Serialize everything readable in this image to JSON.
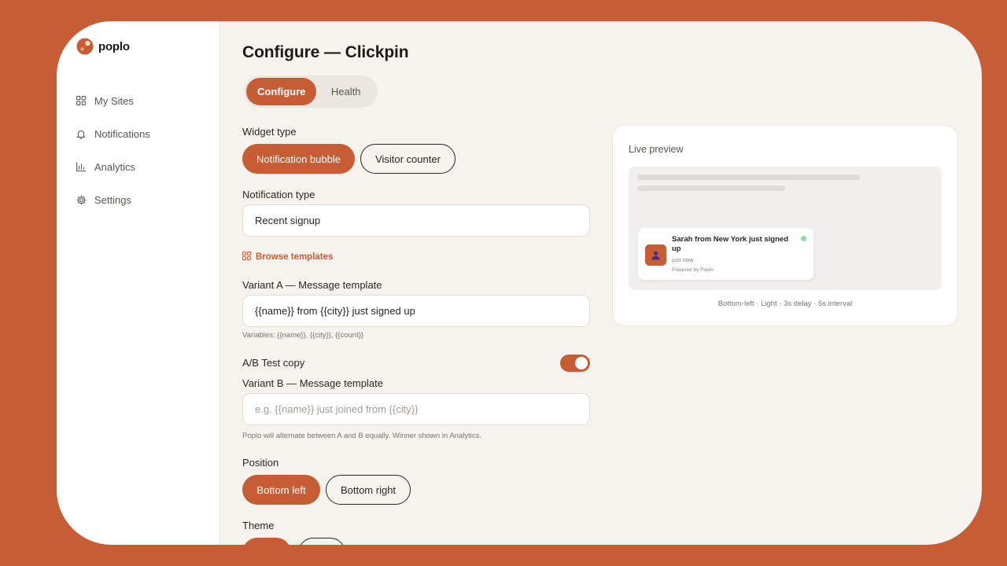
{
  "app": {
    "name": "poplo"
  },
  "sidebar": {
    "items": [
      {
        "label": "My Sites",
        "icon": "grid-icon"
      },
      {
        "label": "Notifications",
        "icon": "bell-icon"
      },
      {
        "label": "Analytics",
        "icon": "bar-chart-icon"
      },
      {
        "label": "Settings",
        "icon": "gear-icon"
      }
    ]
  },
  "page": {
    "title": "Configure — Clickpin"
  },
  "tabs": [
    {
      "label": "Configure",
      "active": true
    },
    {
      "label": "Health",
      "active": false
    }
  ],
  "form": {
    "widget_type": {
      "label": "Widget type",
      "options": [
        "Notification bubble",
        "Visitor counter"
      ],
      "selected": "Notification bubble"
    },
    "notification_type": {
      "label": "Notification type",
      "value": "Recent signup"
    },
    "browse_templates": "Browse templates",
    "variant_a": {
      "label": "Variant A — Message template",
      "value": "{{name}} from {{city}} just signed up",
      "hint": "Variables: {{name}}, {{city}}, {{count}}"
    },
    "ab_test": {
      "label": "A/B Test copy",
      "enabled": true
    },
    "variant_b": {
      "label": "Variant B — Message template",
      "placeholder": "e.g. {{name}} just joined from {{city}}",
      "hint": "Poplo will alternate between A and B equally. Winner shown in Analytics."
    },
    "position": {
      "label": "Position",
      "options": [
        "Bottom left",
        "Bottom right"
      ],
      "selected": "Bottom left"
    },
    "theme": {
      "label": "Theme"
    }
  },
  "preview": {
    "title": "Live preview",
    "notification": {
      "message": "Sarah from New York just signed up",
      "time": "just now",
      "powered": "Powered by Poplo"
    },
    "meta": "Bottom-left · Light · 3s delay · 5s interval"
  },
  "colors": {
    "accent": "#c65d35",
    "background": "#f6f3ee",
    "status_dot": "#8fd9a8"
  }
}
